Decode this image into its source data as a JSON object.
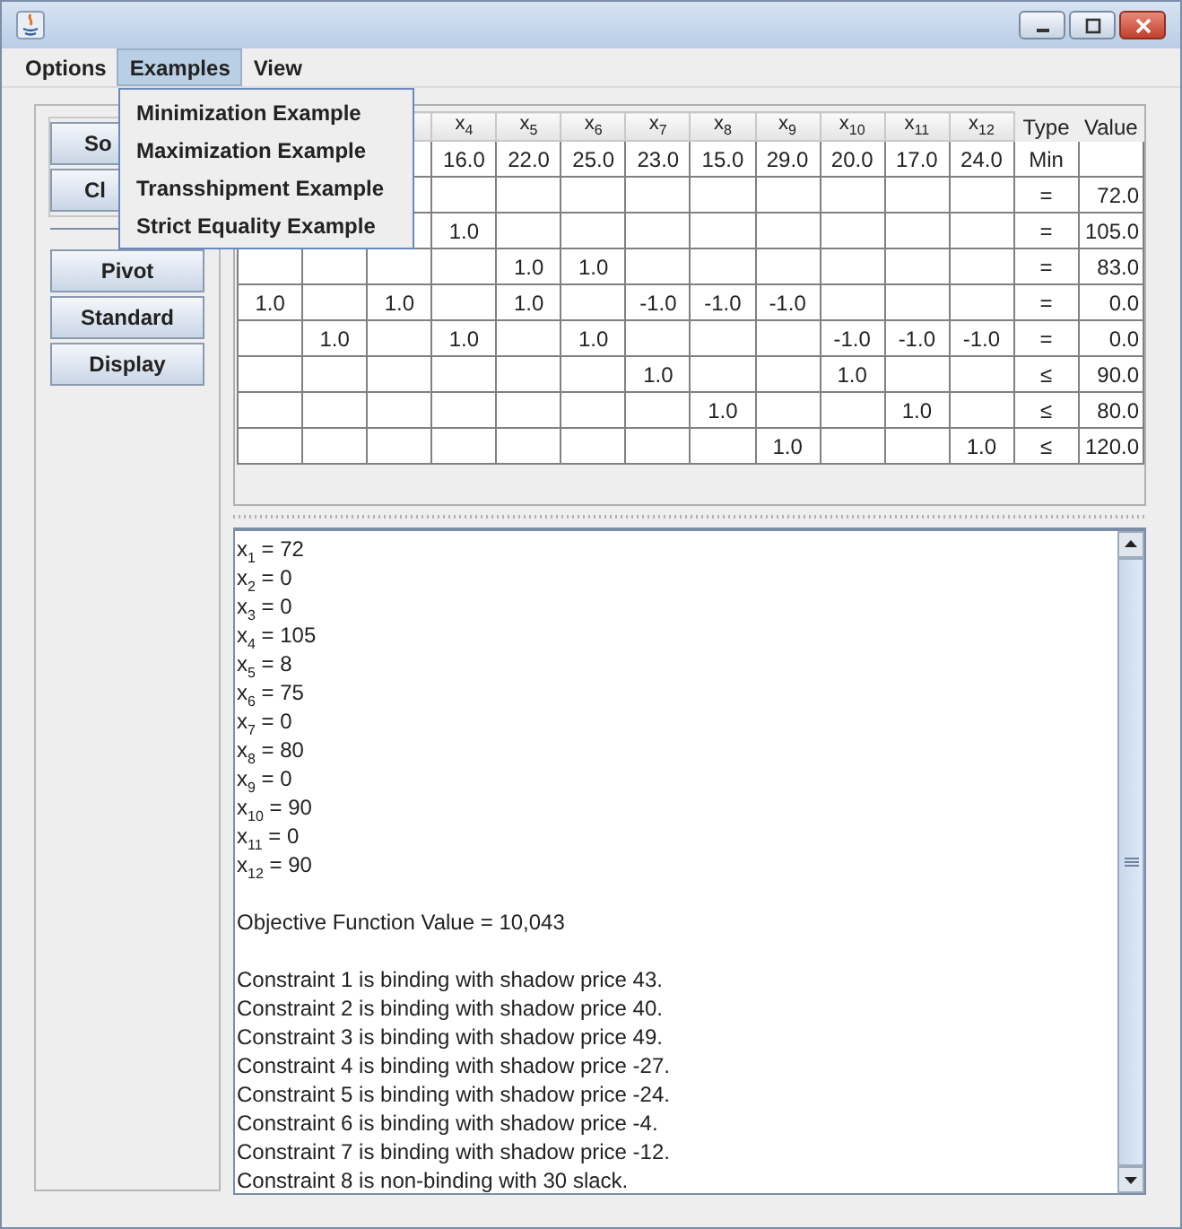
{
  "menu_bar": [
    {
      "label": "Options",
      "selected": false
    },
    {
      "label": "Examples",
      "selected": true
    },
    {
      "label": "View",
      "selected": false
    }
  ],
  "examples_menu": [
    "Minimization Example",
    "Maximization Example",
    "Transshipment Example",
    "Strict Equality Example"
  ],
  "side_buttons": [
    {
      "label": "So",
      "clipped": true
    },
    {
      "label": "Cl",
      "clipped": true
    }
  ],
  "tool_buttons": [
    "Pivot",
    "Standard",
    "Display"
  ],
  "table": {
    "columns": [
      null,
      null,
      null,
      "x$_{4}$",
      "x$_{5}$",
      "x$_{6}$",
      "x$_{7}$",
      "x$_{8}$",
      "x$_{9}$",
      "x$_{10}$",
      "x$_{11}$",
      "x$_{12}$",
      "Type",
      "Value"
    ],
    "rows": [
      [
        null,
        null,
        null,
        "16.0",
        "22.0",
        "25.0",
        "23.0",
        "15.0",
        "29.0",
        "20.0",
        "17.0",
        "24.0",
        "Min",
        null
      ],
      [
        null,
        null,
        null,
        null,
        null,
        null,
        null,
        null,
        null,
        null,
        null,
        null,
        "=",
        "72.0"
      ],
      [
        null,
        null,
        null,
        "1.0",
        null,
        null,
        null,
        null,
        null,
        null,
        null,
        null,
        "=",
        "105.0"
      ],
      [
        null,
        null,
        null,
        null,
        "1.0",
        "1.0",
        null,
        null,
        null,
        null,
        null,
        null,
        "=",
        "83.0"
      ],
      [
        "1.0",
        null,
        "1.0",
        null,
        "1.0",
        null,
        "-1.0",
        "-1.0",
        "-1.0",
        null,
        null,
        null,
        "=",
        "0.0"
      ],
      [
        null,
        "1.0",
        null,
        "1.0",
        null,
        "1.0",
        null,
        null,
        null,
        "-1.0",
        "-1.0",
        "-1.0",
        "=",
        "0.0"
      ],
      [
        null,
        null,
        null,
        null,
        null,
        null,
        "1.0",
        null,
        null,
        "1.0",
        null,
        null,
        "≤",
        "90.0"
      ],
      [
        null,
        null,
        null,
        null,
        null,
        null,
        null,
        "1.0",
        null,
        null,
        "1.0",
        null,
        "≤",
        "80.0"
      ],
      [
        null,
        null,
        null,
        null,
        null,
        null,
        null,
        null,
        "1.0",
        null,
        null,
        "1.0",
        "≤",
        "120.0"
      ]
    ]
  },
  "output": {
    "variables": [
      "x$_{1}$ = 72",
      "x$_{2}$ = 0",
      "x$_{3}$ = 0",
      "x$_{4}$ = 105",
      "x$_{5}$ = 8",
      "x$_{6}$ = 75",
      "x$_{7}$ = 0",
      "x$_{8}$ = 80",
      "x$_{9}$ = 0",
      "x$_{10}$ = 90",
      "x$_{11}$ = 0",
      "x$_{12}$ = 90"
    ],
    "objective": "Objective Function Value = 10,043",
    "constraints": [
      "Constraint 1 is binding with shadow price 43.",
      "Constraint 2 is binding with shadow price 40.",
      "Constraint 3 is binding with shadow price 49.",
      "Constraint 4 is binding with shadow price -27.",
      "Constraint 5 is binding with shadow price -24.",
      "Constraint 6 is binding with shadow price -4.",
      "Constraint 7 is binding with shadow price -12.",
      "Constraint 8 is non-binding with 30 slack."
    ]
  }
}
